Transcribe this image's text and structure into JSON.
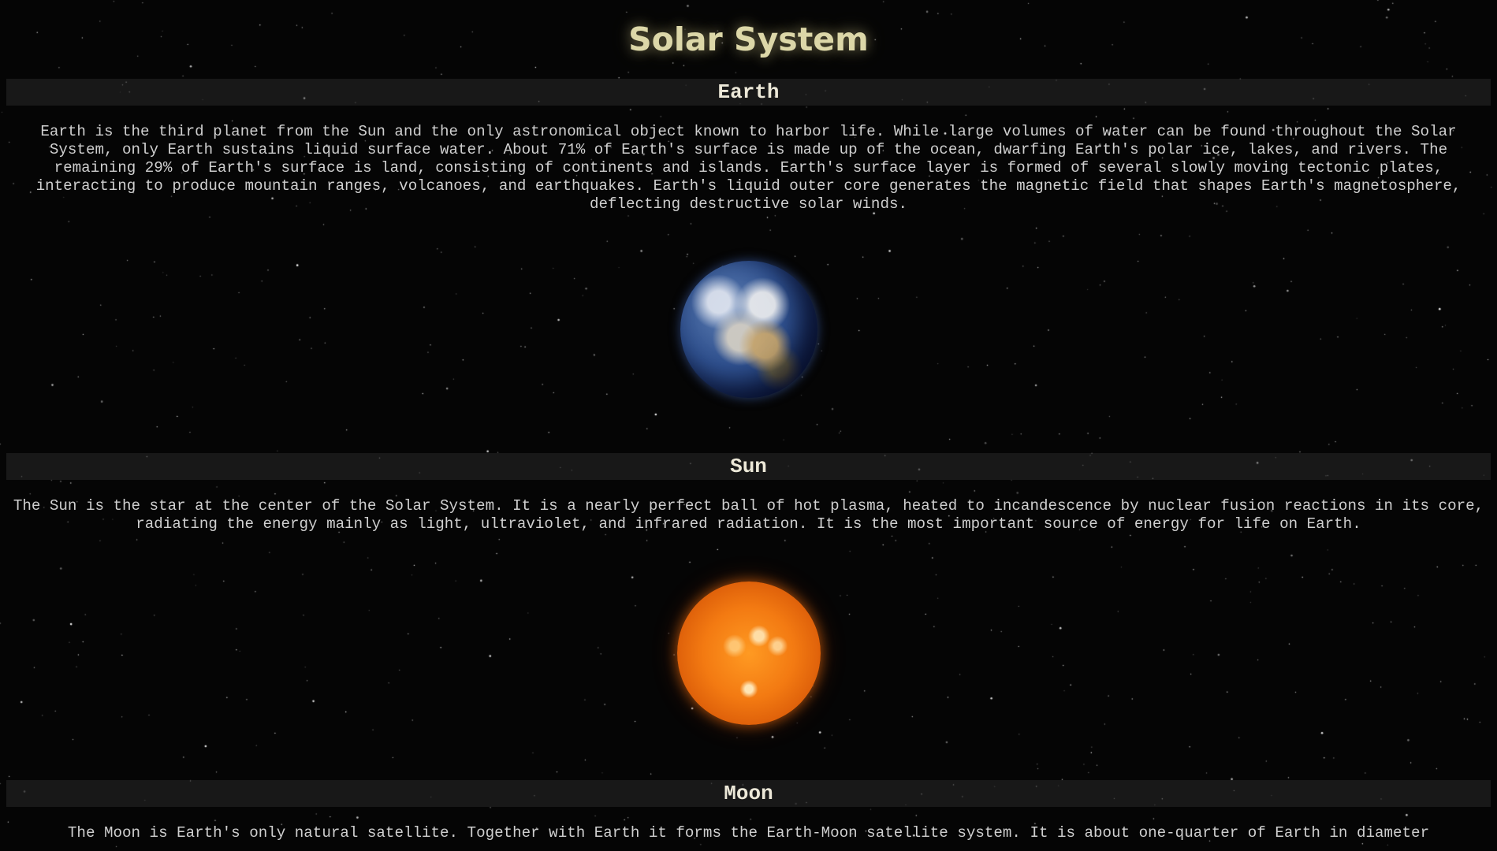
{
  "page": {
    "title": "Solar System"
  },
  "sections": [
    {
      "heading": "Earth",
      "text": "Earth is the third planet from the Sun and the only astronomical object known to harbor life. While large volumes of water can be found throughout the Solar System, only Earth sustains liquid surface water. About 71% of Earth's surface is made up of the ocean, dwarfing Earth's polar ice, lakes, and rivers. The remaining 29% of Earth's surface is land, consisting of continents and islands. Earth's surface layer is formed of several slowly moving tectonic plates, interacting to produce mountain ranges, volcanoes, and earthquakes. Earth's liquid outer core generates the magnetic field that shapes Earth's magnetosphere, deflecting destructive solar winds.",
      "image_icon": "earth-globe"
    },
    {
      "heading": "Sun",
      "text": "The Sun is the star at the center of the Solar System. It is a nearly perfect ball of hot plasma, heated to incandescence by nuclear fusion reactions in its core, radiating the energy mainly as light, ultraviolet, and infrared radiation. It is the most important source of energy for life on Earth.",
      "image_icon": "sun-disk"
    },
    {
      "heading": "Moon",
      "text": "The Moon is Earth's only natural satellite. Together with Earth it forms the Earth-Moon satellite system. It is about one-quarter of Earth in diameter"
    }
  ],
  "colors": {
    "background": "#050505",
    "title": "#dcd7a8",
    "heading": "#ece8d8",
    "body_text": "#cfcfcf",
    "section_bar": "#1c1c1c"
  }
}
